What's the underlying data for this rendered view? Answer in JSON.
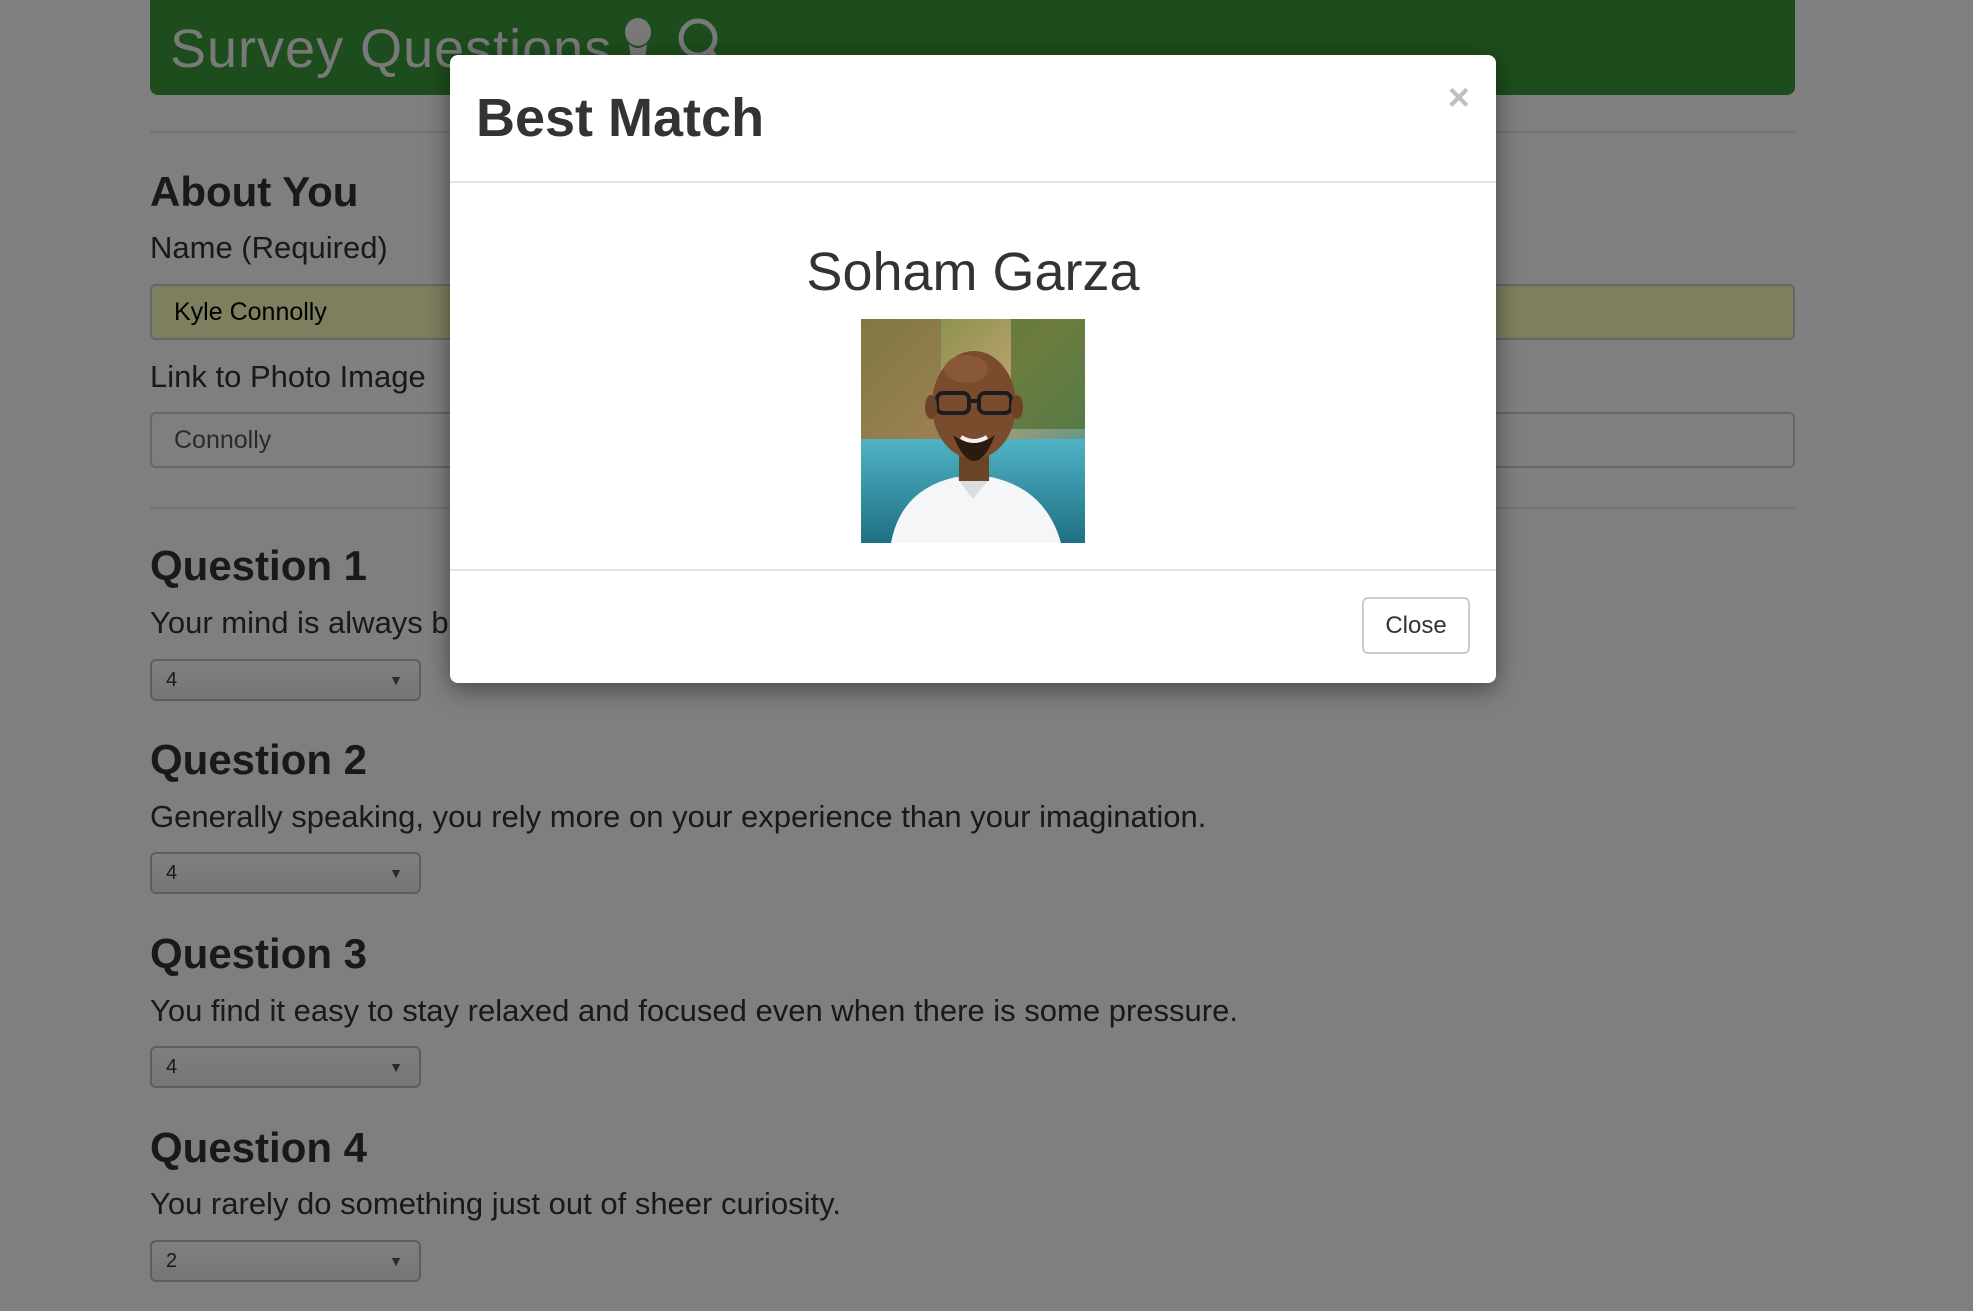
{
  "banner": {
    "title": "Survey Questions",
    "icons": [
      "user-icon",
      "search-icon"
    ],
    "color": "#3a9a3a"
  },
  "about": {
    "section_title": "About You",
    "name_label": "Name (Required)",
    "name_value": "Kyle Connolly",
    "photo_label": "Link to Photo Image",
    "photo_value": "Connolly"
  },
  "questions": [
    {
      "title": "Question 1",
      "text": "Your mind is always b",
      "answer": "4"
    },
    {
      "title": "Question 2",
      "text": "Generally speaking, you rely more on your experience than your imagination.",
      "answer": "4"
    },
    {
      "title": "Question 3",
      "text": "You find it easy to stay relaxed and focused even when there is some pressure.",
      "answer": "4"
    },
    {
      "title": "Question 4",
      "text": "You rarely do something just out of sheer curiosity.",
      "answer": "2"
    }
  ],
  "modal": {
    "title": "Best Match",
    "close_x": "×",
    "match_name": "Soham Garza",
    "photo_alt": "profile-photo",
    "close_button_label": "Close"
  },
  "select_arrow": "▼"
}
